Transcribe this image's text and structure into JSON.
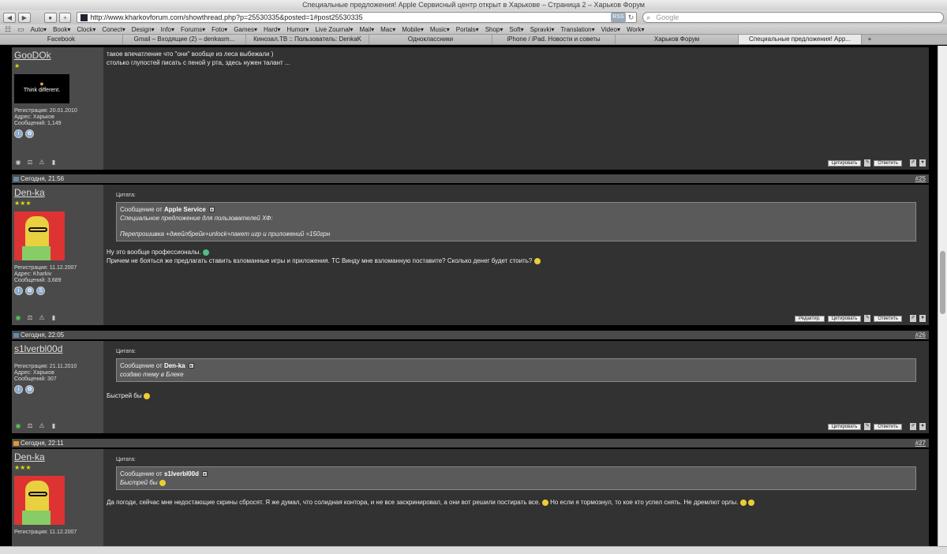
{
  "browser": {
    "title": "Специальные предложения! Apple Сервисный центр открыт в Харькове – Страница 2 – Харьков Форум",
    "url": "http://www.kharkovforum.com/showthread.php?p=25530335&posted=1#post25530335",
    "rss": "RSS",
    "search_placeholder": "Google",
    "bookmarks": [
      "Auto▾",
      "Book▾",
      "Clock▾",
      "Conect▾",
      "Design▾",
      "Info▾",
      "Forums▾",
      "Foto▾",
      "Games▾",
      "Hard▾",
      "Humor▾",
      "Live Zournal▾",
      "Mail▾",
      "Mac▾",
      "Mobile▾",
      "Music▾",
      "Portals▾",
      "Shop▾",
      "Soft▾",
      "Spravki▾",
      "Translation▾",
      "Video▾",
      "Work▾"
    ],
    "tabs": [
      "Facebook",
      "Gmail – Входящие (2) – denkasm...",
      "Кинозал.ТВ :: Пользователь: DenkaK",
      "Одноклассники",
      "iPhone / iPad. Новости и советы",
      "Харьков Форум",
      "Специальные предложения! App..."
    ]
  },
  "actions": {
    "quote": "Цитировать",
    "reply": "Ответить",
    "edit": "Редактир."
  },
  "posts": [
    {
      "user": "GooDOk",
      "stars": "★",
      "avatar_text": "Think different.",
      "reg": "Регистрация: 20.01.2010",
      "addr": "Адрес: Харьков",
      "count": "Сообщений: 1,149",
      "text1": "такое впечатление что \"они\" вообще из леса выбежали )",
      "text2": "столько глупостей писать с пеной у рта, здесь нужен талант ..."
    },
    {
      "date": "Сегодня, 21:56",
      "num": "#25",
      "user": "Den-ka",
      "stars": "★★★",
      "reg": "Регистрация: 11.12.2007",
      "addr": "Адрес: Kharkiv",
      "count": "Сообщений: 3,689",
      "quote_label": "Цитата:",
      "quote_from": "Сообщение от",
      "quote_author": "Apple Service",
      "quote_line1": "Специальное предложение для пользователей ХФ:",
      "quote_line2": "Перепрошивка +джейлбрейк+unlock+пакет игр и приложений =150грн",
      "text1": "Ну это вообще профессионалы.",
      "text2": "Причем не бояться же предлагать ставить взломанные игры и приложения. ТС Винду мне взломанную поставите? Сколько денег будет стоить?"
    },
    {
      "date": "Сегодня, 22:05",
      "num": "#26",
      "user": "s1lverbl00d",
      "reg": "Регистрация: 21.11.2010",
      "addr": "Адрес: Харьков",
      "count": "Сообщений: 307",
      "quote_label": "Цитата:",
      "quote_from": "Сообщение от",
      "quote_author": "Den-ka",
      "quote_line1": "создаю тему в Блеке",
      "text1": "Быстрей бы"
    },
    {
      "date": "Сегодня, 22:11",
      "num": "#27",
      "user": "Den-ka",
      "stars": "★★★",
      "reg": "Регистрация: 11.12.2007",
      "quote_label": "Цитата:",
      "quote_from": "Сообщение от",
      "quote_author": "s1lverbl00d",
      "quote_line1": "Быстрей бы",
      "text1": "Да погоди, сейчас мне недостающие скрины сбросят. Я же думал, что солидная контора, и не все заскринировал, а они вот решили постирать все.",
      "text2": "Но если я тормознул, то кое кто успел снять. Не дремлют орлы."
    }
  ]
}
